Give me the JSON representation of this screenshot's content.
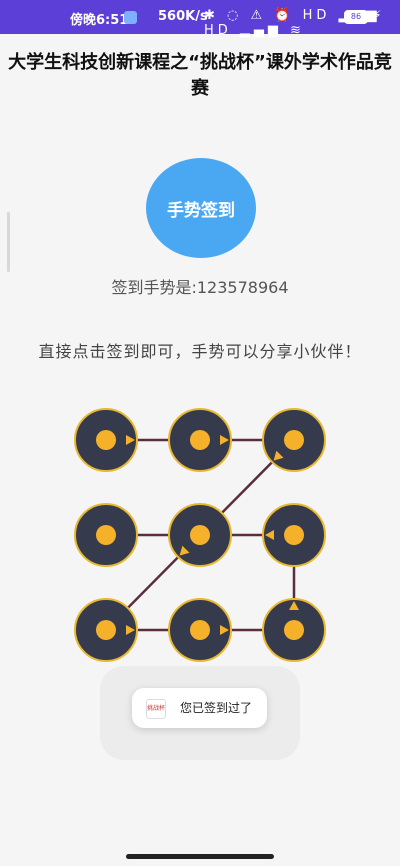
{
  "status_bar": {
    "time": "傍晚6:51",
    "speed": "560K/s",
    "icons": "✱ ◌ ⚠ ⏰ HD ▂▄▆ HD ▂▄▆ ≋",
    "battery": "86"
  },
  "page": {
    "title": "大学生科技创新课程之“挑战杯”课外学术作品竞赛",
    "sign_button_label": "手势签到",
    "gesture_code_text": "签到手势是:123578964",
    "instruction": "直接点击签到即可，手势可以分享小伙伴！"
  },
  "pattern": {
    "sequence": [
      1,
      2,
      3,
      5,
      7,
      8,
      9,
      6,
      4
    ],
    "node_fill": "#363a4d",
    "node_border": "#e8b830",
    "dot_color": "#f6b12a",
    "line_color": "#5a2e3e"
  },
  "toast": {
    "logo_text": "挑战杯",
    "message": "您已签到过了"
  }
}
